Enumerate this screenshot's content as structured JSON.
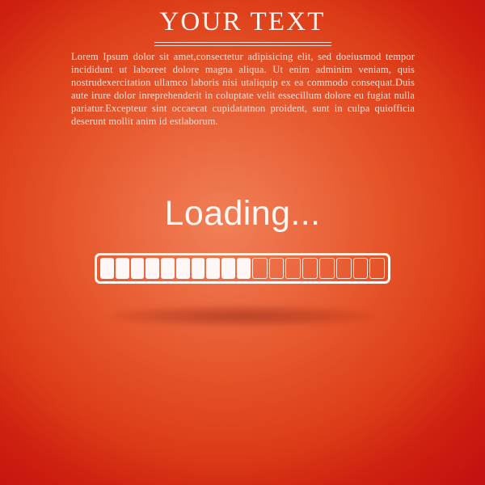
{
  "header": {
    "title": "YOUR TEXT",
    "divider_rules": 2,
    "body_text": "Lorem Ipsum dolor sit amet,consectetur adipisicing elit, sed doeiusmod tempor incididunt ut laboreet dolore magna aliqua. Ut enim adminim veniam, quis nostrudexercitation ullamco laboris nisi utaliquip ex ea commodo consequat.Duis aute irure dolor inreprehenderit in coluptate velit essecillum dolore eu fugiat nulla pariatur.Excepteur sint occaecat cupidatatnon proident, sunt in culpa quiofficia deserunt mollit anim id estlaborum."
  },
  "loader": {
    "label": "Loading...",
    "total_segments": 18,
    "filled_segments": 10,
    "percent": 56
  },
  "colors": {
    "background_center": "#f08057",
    "background_edge": "#c41010",
    "foreground": "#fdf7f4",
    "body_text": "#fbdfd5"
  }
}
